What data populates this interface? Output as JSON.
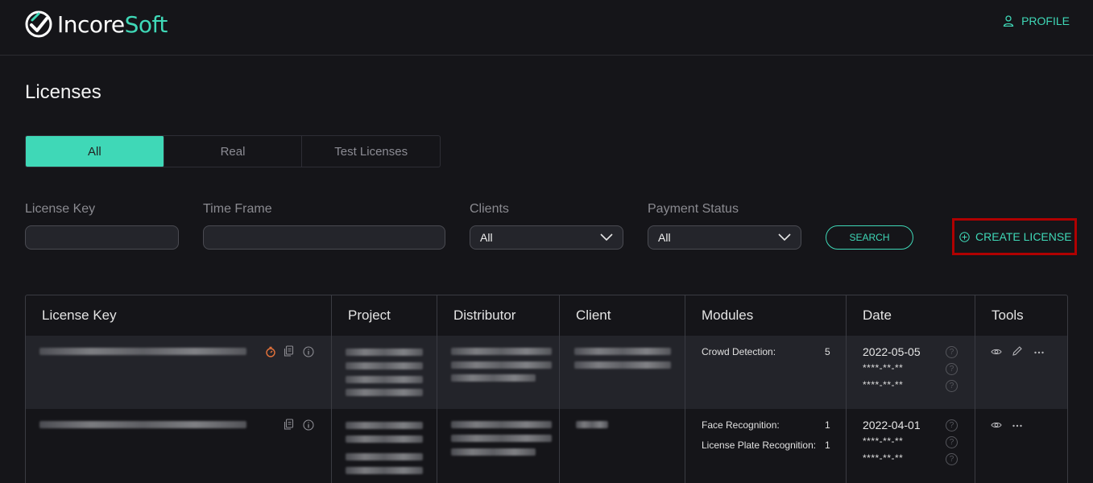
{
  "header": {
    "logo_prefix": "Incore",
    "logo_suffix": "Soft",
    "profile_label": "PROFILE"
  },
  "page": {
    "title": "Licenses"
  },
  "tabs": [
    {
      "label": "All",
      "active": true
    },
    {
      "label": "Real",
      "active": false
    },
    {
      "label": "Test Licenses",
      "active": false
    }
  ],
  "filters": {
    "license_key_label": "License Key",
    "license_key_value": "",
    "time_frame_label": "Time Frame",
    "time_frame_value": "",
    "clients_label": "Clients",
    "clients_value": "All",
    "payment_status_label": "Payment Status",
    "payment_status_value": "All",
    "search_label": "SEARCH",
    "create_label": "CREATE LICENSE"
  },
  "table": {
    "columns": [
      "License Key",
      "Project",
      "Distributor",
      "Client",
      "Modules",
      "Date",
      "Tools"
    ],
    "rows": [
      {
        "modules": [
          {
            "name": "Crowd Detection:",
            "count": "5"
          }
        ],
        "dates": [
          "2022-05-05",
          "****-**-**",
          "****-**-**"
        ]
      },
      {
        "modules": [
          {
            "name": "Face Recognition:",
            "count": "1"
          },
          {
            "name": "License Plate Recognition:",
            "count": "1"
          }
        ],
        "dates": [
          "2022-04-01",
          "****-**-**",
          "****-**-**"
        ]
      }
    ]
  },
  "colors": {
    "accent": "#3fd8b7",
    "background": "#151519",
    "highlight_border": "#b00000",
    "timer_icon": "#e8743b"
  }
}
